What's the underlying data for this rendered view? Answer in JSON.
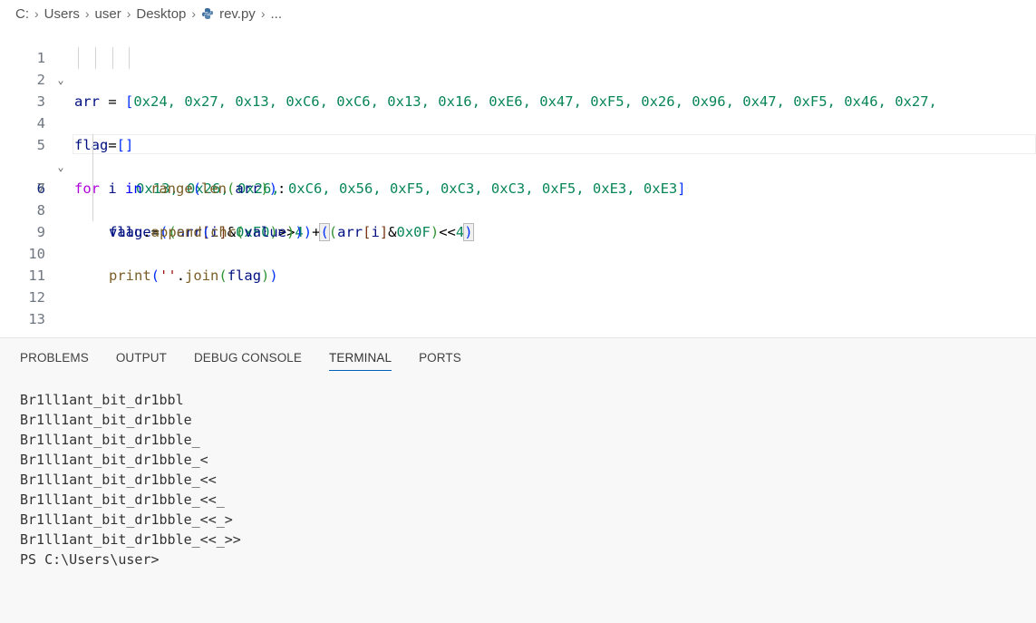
{
  "breadcrumb": {
    "items": [
      "C:",
      "Users",
      "user",
      "Desktop",
      "rev.py",
      "..."
    ]
  },
  "editor": {
    "line_numbers": [
      "1",
      "2",
      "3",
      "4",
      "5",
      "6",
      "7",
      "8",
      "9",
      "10",
      "11",
      "12",
      "13"
    ],
    "active_line": 6,
    "code": {
      "l1_arr": "arr",
      "l1_eq": " = ",
      "l1_open": "[",
      "l1_vals": "0x24, 0x27, 0x13, 0xC6, 0xC6, 0x13, 0x16, 0xE6, 0x47, 0xF5, 0x26, 0x96, 0x47, 0xF5, 0x46, 0x27,",
      "l2_vals": "0x13, 0x26, 0x26, 0xC6, 0x56, 0xF5, 0xC3, 0xC3, 0xF5, 0xE3, 0xE3",
      "l2_close": "]",
      "l4_flag": "flag",
      "l4_rest": "=",
      "l4_brackets": "[]",
      "l5_for": "for",
      "l5_i": " i ",
      "l5_in": "in",
      "l5_range": " range",
      "l5_p1": "(",
      "l5_len": "len",
      "l5_p2": "(",
      "l5_arr": "arr",
      "l5_p3": ")",
      "l5_p4": ")",
      "l5_colon": ":",
      "l6_value": "value",
      "l6_eq": "=",
      "l6_p1": "(",
      "l6_p2": "(",
      "l6_arr": "arr",
      "l6_b1": "[",
      "l6_i": "i",
      "l6_b2": "]",
      "l6_and": "&",
      "l6_hex1": "0xF0",
      "l6_p3": ")",
      "l6_shr": ">>",
      "l6_n4": "4",
      "l6_p4": ")",
      "l6_plus": "+",
      "l6_p5": "(",
      "l6_p6": "(",
      "l6_arr2": "arr",
      "l6_b3": "[",
      "l6_i2": "i",
      "l6_b4": "]",
      "l6_and2": "&",
      "l6_hex2": "0x0F",
      "l6_p7": ")",
      "l6_shl": "<<",
      "l6_n4b": "4",
      "l6_p8": ")",
      "l7_flag": "flag",
      "l7_dot": ".",
      "l7_append": "append",
      "l7_p1": "(",
      "l7_chr": "chr",
      "l7_p2": "(",
      "l7_value": "value",
      "l7_p3": ")",
      "l7_p4": ")",
      "l9_print": "print",
      "l9_p1": "(",
      "l9_str": "''",
      "l9_dot": ".",
      "l9_join": "join",
      "l9_p2": "(",
      "l9_flag": "flag",
      "l9_p3": ")",
      "l9_p4": ")"
    }
  },
  "panel": {
    "tabs": [
      {
        "label": "PROBLEMS"
      },
      {
        "label": "OUTPUT"
      },
      {
        "label": "DEBUG CONSOLE"
      },
      {
        "label": "TERMINAL"
      },
      {
        "label": "PORTS"
      }
    ],
    "active_tab": "TERMINAL",
    "terminal_lines": [
      "Br1ll1ant_bit_dr1bbl",
      "Br1ll1ant_bit_dr1bble",
      "Br1ll1ant_bit_dr1bble_",
      "Br1ll1ant_bit_dr1bble_<",
      "Br1ll1ant_bit_dr1bble_<<",
      "Br1ll1ant_bit_dr1bble_<<_",
      "Br1ll1ant_bit_dr1bble_<<_>",
      "Br1ll1ant_bit_dr1bble_<<_>>",
      "PS C:\\Users\\user>"
    ]
  },
  "colors": {
    "keyword": "#0000ff",
    "control": "#af00db",
    "function": "#795e26",
    "variable": "#001080",
    "number": "#098658",
    "string": "#a31515",
    "active_tab_underline": "#005fb8"
  }
}
